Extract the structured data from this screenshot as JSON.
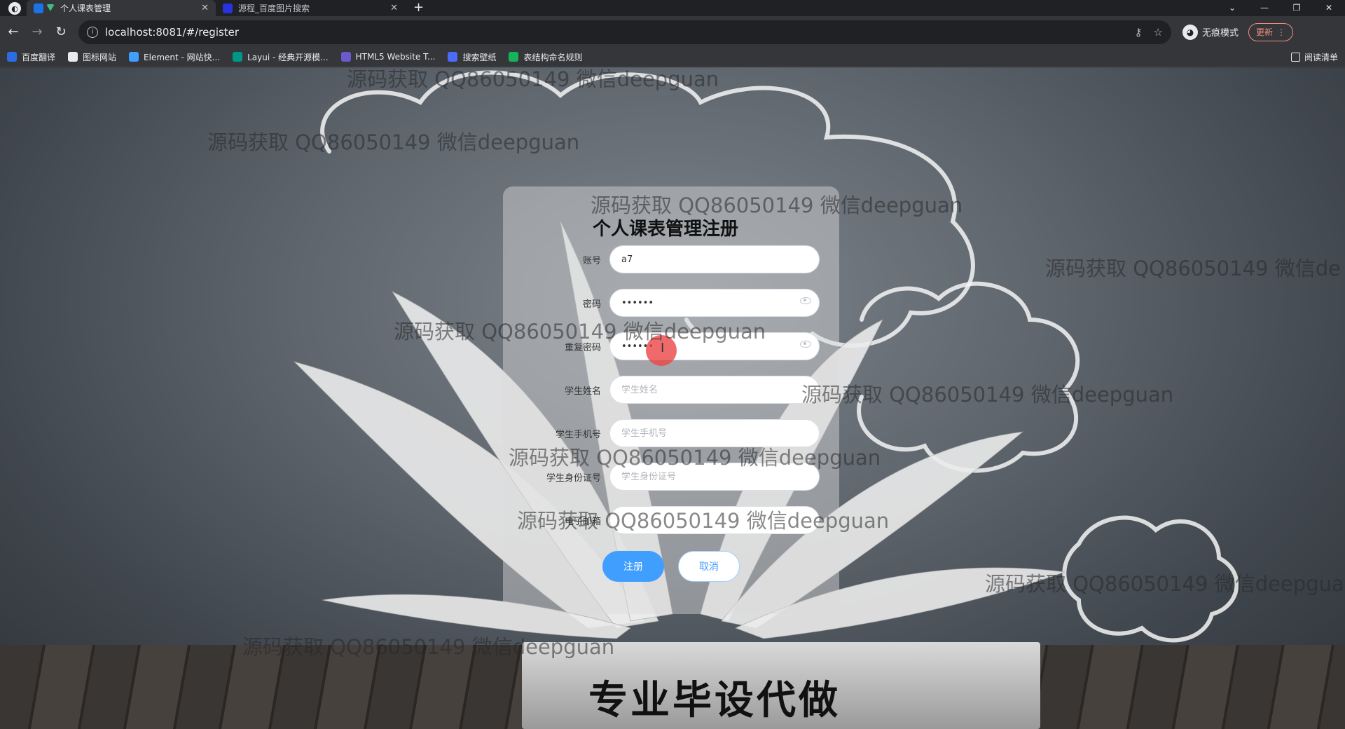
{
  "browser": {
    "logo_glyph": "◐",
    "tabs": [
      {
        "title": "个人课表管理",
        "active": true,
        "close": "✕"
      },
      {
        "title": "源程_百度图片搜索",
        "active": false,
        "close": "✕"
      }
    ],
    "new_tab": "+",
    "window_controls": {
      "menu": "⌄",
      "minimize": "—",
      "restore": "❐",
      "close": "✕"
    },
    "url": "localhost:8081/#/register",
    "incognito_label": "无痕模式",
    "update_label": "更新",
    "bookmarks": [
      {
        "label": "百度翻译",
        "color": "#2b6de0"
      },
      {
        "label": "图标网站",
        "color": "#e8eaed"
      },
      {
        "label": "Element - 网站快...",
        "color": "#409eff"
      },
      {
        "label": "Layui - 经典开源模...",
        "color": "#009688"
      },
      {
        "label": "HTML5 Website T...",
        "color": "#6a5acd"
      },
      {
        "label": "搜索壁纸",
        "color": "#4a6cf7"
      },
      {
        "label": "表结构命名规则",
        "color": "#16b35a"
      }
    ],
    "reading_list": "阅读清单"
  },
  "watermark_text": "源码获取 QQ86050149 微信deepguan",
  "watermark_partial": "源码获取 QQ86050149 微信de",
  "watermark_partial2": "源码获取 QQ86050149 微信deepgua",
  "form": {
    "title": "个人课表管理注册",
    "fields": [
      {
        "label": "账号",
        "value": "a7",
        "placeholder": ""
      },
      {
        "label": "密码",
        "value": "••••••",
        "placeholder": ""
      },
      {
        "label": "重复密码",
        "value": "••••••",
        "placeholder": ""
      },
      {
        "label": "学生姓名",
        "value": "",
        "placeholder": "学生姓名"
      },
      {
        "label": "学生手机号",
        "value": "",
        "placeholder": "学生手机号"
      },
      {
        "label": "学生身份证号",
        "value": "",
        "placeholder": "学生身份证号"
      },
      {
        "label": "电子邮箱",
        "value": "",
        "placeholder": ""
      }
    ],
    "submit_label": "注册",
    "cancel_label": "取消"
  },
  "banner": {
    "slogan": "专业毕设代做"
  },
  "colors": {
    "primary": "#409eff",
    "accent_red": "#f28b82"
  }
}
